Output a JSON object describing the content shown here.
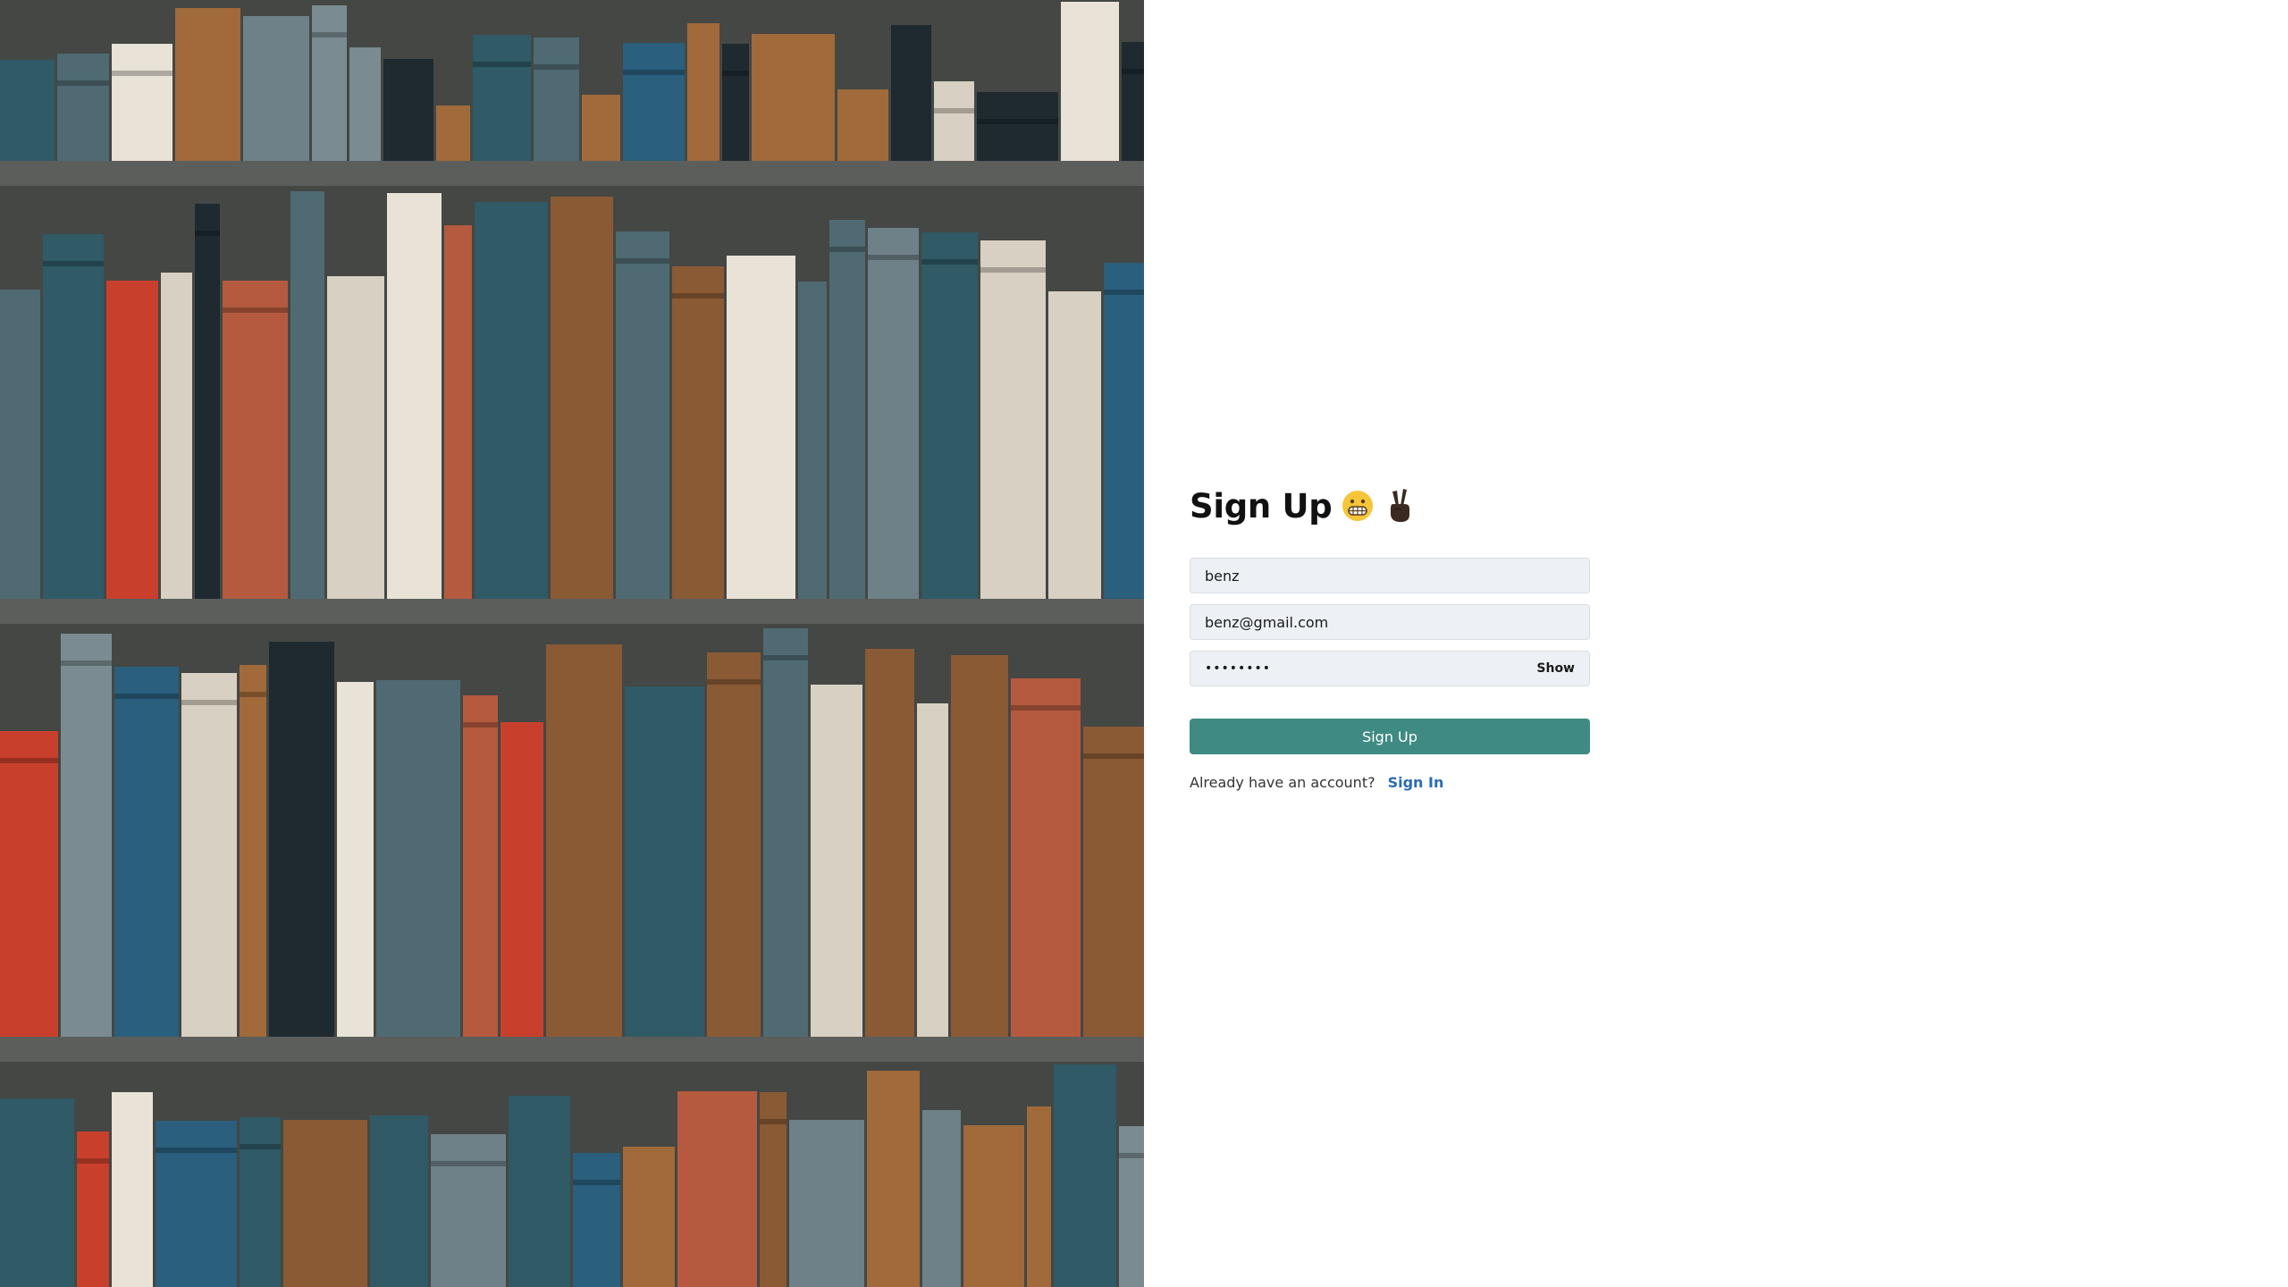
{
  "hero": {
    "image": "bookshelf-photo"
  },
  "form": {
    "title": "Sign Up",
    "title_emojis": [
      "grimacing-face-icon",
      "victory-hand-icon"
    ],
    "name_value": "benz",
    "email_value": "benz@gmail.com",
    "password_value": "••••••••",
    "show_label": "Show",
    "submit_label": "Sign Up",
    "have_account_text": "Already have an account?",
    "signin_label": "Sign In"
  },
  "colors": {
    "accent": "#3f8a82",
    "link": "#2b6cb0",
    "field_bg": "#edf1f6"
  }
}
